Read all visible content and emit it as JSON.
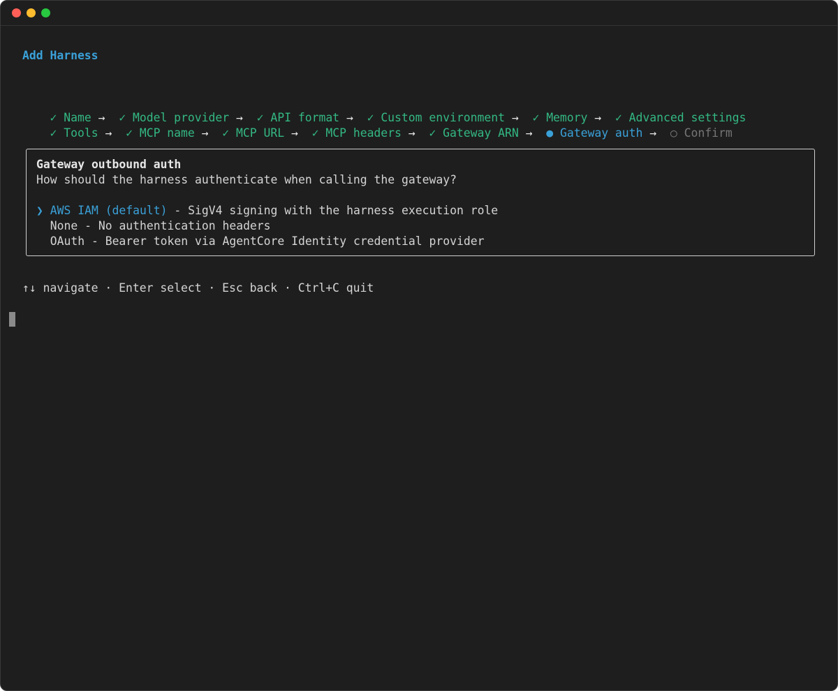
{
  "window": {
    "controls": [
      "close",
      "minimize",
      "maximize"
    ]
  },
  "header": {
    "title": "Add Harness"
  },
  "steps": {
    "row1": [
      {
        "mark": "✓",
        "label": "Name",
        "arrow": "→",
        "state": "done"
      },
      {
        "mark": "✓",
        "label": "Model provider",
        "arrow": "→",
        "state": "done"
      },
      {
        "mark": "✓",
        "label": "API format",
        "arrow": "→",
        "state": "done"
      },
      {
        "mark": "✓",
        "label": "Custom environment",
        "arrow": "→",
        "state": "done"
      },
      {
        "mark": "✓",
        "label": "Memory",
        "arrow": "→",
        "state": "done"
      },
      {
        "mark": "✓",
        "label": "Advanced settings",
        "arrow": "",
        "state": "done"
      }
    ],
    "row2": [
      {
        "mark": "✓",
        "label": "Tools",
        "arrow": "→",
        "state": "done"
      },
      {
        "mark": "✓",
        "label": "MCP name",
        "arrow": "→",
        "state": "done"
      },
      {
        "mark": "✓",
        "label": "MCP URL",
        "arrow": "→",
        "state": "done"
      },
      {
        "mark": "✓",
        "label": "MCP headers",
        "arrow": "→",
        "state": "done"
      },
      {
        "mark": "✓",
        "label": "Gateway ARN",
        "arrow": "→",
        "state": "done"
      },
      {
        "mark": "●",
        "label": "Gateway auth",
        "arrow": "→",
        "state": "active"
      },
      {
        "mark": "○",
        "label": "Confirm",
        "arrow": "",
        "state": "pending"
      }
    ]
  },
  "prompt": {
    "title": "Gateway outbound auth",
    "question": "How should the harness authenticate when calling the gateway?",
    "pointer": "❯",
    "options": [
      {
        "label": "AWS IAM (default)",
        "description": " - SigV4 signing with the harness execution role",
        "selected": true
      },
      {
        "label": "None",
        "description": " - No authentication headers",
        "selected": false
      },
      {
        "label": "OAuth",
        "description": " - Bearer token via AgentCore Identity credential provider",
        "selected": false
      }
    ]
  },
  "footer": {
    "hint": "↑↓ navigate · Enter select · Esc back · Ctrl+C quit"
  },
  "colors": {
    "background": "#1e1e1e",
    "accent": "#3aa0d8",
    "done": "#33b883",
    "pending": "#767676"
  }
}
